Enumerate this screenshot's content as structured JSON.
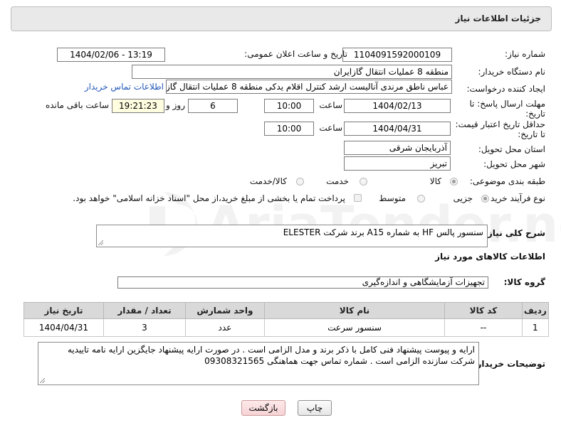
{
  "header": {
    "title": "جزئیات اطلاعات نیاز"
  },
  "fields": {
    "need_number_label": "شماره نیاز:",
    "need_number": "1104091592000109",
    "announce_label": "تاریخ و ساعت اعلان عمومی:",
    "announce_value": "1404/02/06 - 13:19",
    "buyer_org_label": "نام دستگاه خریدار:",
    "buyer_org": "منطقه 8 عملیات انتقال گازایران",
    "creator_label": "ایجاد کننده درخواست:",
    "creator": "عباس ناطق مرندی آنالیست ارشد کنترل اقلام یدکی منطقه 8 عملیات انتقال گاز",
    "buyer_contact_link": "اطلاعات تماس خریدار",
    "deadline_label_1": "مهلت ارسال پاسخ: تا",
    "deadline_label_2": "تاریخ:",
    "deadline_date": "1404/02/13",
    "time_label": "ساعت",
    "deadline_time": "10:00",
    "days_value": "6",
    "days_label": "روز و",
    "remaining_time": "19:21:23",
    "remaining_label": "ساعت باقی مانده",
    "price_label_1": "حداقل تاریخ اعتبار قیمت:",
    "price_label_2": "تا تاریخ:",
    "price_date": "1404/04/31",
    "price_time": "10:00",
    "province_label": "استان محل تحویل:",
    "province": "آذربایجان شرقی",
    "city_label": "شهر محل تحویل:",
    "city": "تبریز",
    "category_label": "طبقه بندی موضوعی:",
    "category_options": [
      "کالا",
      "خدمت",
      "کالا/خدمت"
    ],
    "process_label": "نوع فرآیند خرید :",
    "process_options": [
      "جزیی",
      "متوسط"
    ],
    "payment_note": "پرداخت تمام یا بخشی از مبلغ خرید،از محل \"اسناد خزانه اسلامی\" خواهد بود."
  },
  "description": {
    "label": "شرح کلی نیاز:",
    "text": "سنسور پالس HF به شماره A15 برند شرکت ELESTER"
  },
  "goods": {
    "section_title": "اطلاعات کالاهای مورد نیاز",
    "group_label": "گروه کالا:",
    "group_value": "تجهیزات آزمایشگاهی و اندازه‌گیری",
    "columns": [
      "ردیف",
      "کد کالا",
      "نام کالا",
      "واحد شمارش",
      "تعداد / مقدار",
      "تاریخ نیاز"
    ],
    "rows": [
      [
        "1",
        "--",
        "سنسور سرعت",
        "عدد",
        "3",
        "1404/04/31"
      ]
    ]
  },
  "buyer_notes": {
    "label": "توضیحات خریدار:",
    "text": "ارایه و پیوست پیشنهاد فنی کامل با ذکر برند و مدل الزامی است . در صورت ارایه پیشنهاد جایگزین ارایه نامه تاییدیه شرکت سازنده الزامی است . شماره تماس جهت هماهنگی 09308321565"
  },
  "buttons": {
    "print": "چاپ",
    "back": "بازگشت"
  },
  "colors": {
    "link": "#2358b9",
    "header_bg": "#e9e9e9",
    "table_header": "#d9d9d9"
  }
}
